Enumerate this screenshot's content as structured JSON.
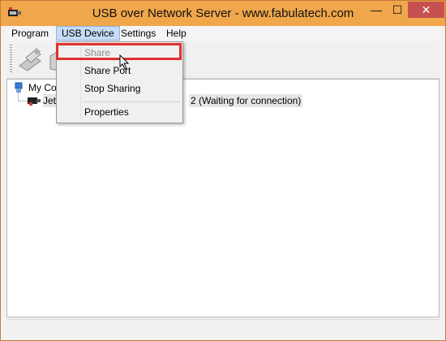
{
  "window": {
    "title": "USB over Network Server - www.fabulatech.com",
    "controls": {
      "minimize": "—",
      "maximize": "☐",
      "close": "✕"
    }
  },
  "menubar": [
    {
      "label": "Program"
    },
    {
      "label": "USB Device"
    },
    {
      "label": "Settings"
    },
    {
      "label": "Help"
    }
  ],
  "dropdown": {
    "items": [
      {
        "label": "Share",
        "enabled": false
      },
      {
        "label": "Share Port",
        "enabled": true
      },
      {
        "label": "Stop Sharing",
        "enabled": true
      },
      {
        "label": "Properties",
        "enabled": true
      }
    ]
  },
  "tree": {
    "root_label": "My Con",
    "device_label_prefix": "Jet",
    "device_label_suffix": "2 (Waiting for connection)"
  },
  "colors": {
    "titlebar": "#f0a64b",
    "close": "#c75050",
    "highlight_box": "#e0312e",
    "menu_active": "#c6dcf5"
  }
}
